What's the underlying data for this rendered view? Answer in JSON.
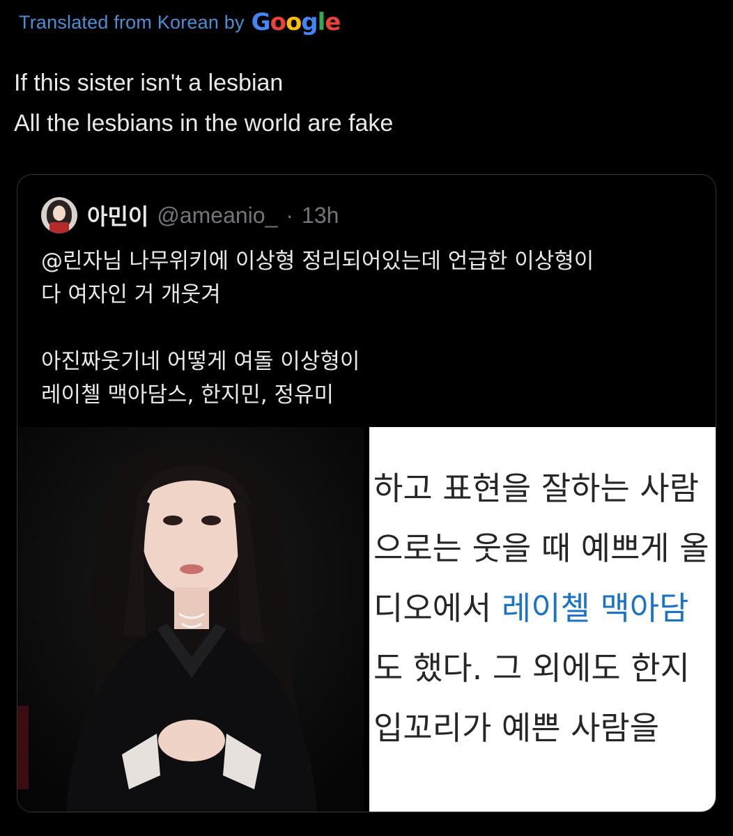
{
  "translation_banner": {
    "text": "Translated from Korean by",
    "logo": [
      "G",
      "o",
      "o",
      "g",
      "l",
      "e"
    ],
    "logo_colors": [
      "#4285f4",
      "#ea4335",
      "#fbbc05",
      "#4285f4",
      "#34a853",
      "#ea4335"
    ]
  },
  "tweet": {
    "lines": [
      "If this sister isn't a lesbian",
      "All the lesbians in the world are fake"
    ]
  },
  "quoted_tweet": {
    "avatar_icon": "profile-photo",
    "display_name": "아민이",
    "handle": "@ameanio_",
    "separator": "·",
    "time": "13h",
    "paragraph1": [
      "@린자님 나무위키에 이상형 정리되어있는데 언급한 이상형이",
      "다 여자인 거 개웃겨"
    ],
    "paragraph2": [
      "아진짜웃기네 어떻게 여돌 이상형이",
      "레이첼 맥아담스, 한지민, 정유미"
    ],
    "media": {
      "photo_description_icon": "woman-portrait-image",
      "document_lines": [
        {
          "before": "하고 표현을 잘하는 사람",
          "link": "",
          "after": ""
        },
        {
          "before": "으로는 웃을 때 예쁘게 올",
          "link": "",
          "after": ""
        },
        {
          "before": "디오에서 ",
          "link": "레이첼 맥아담",
          "after": ""
        },
        {
          "before": "도 했다. 그 외에도 한지",
          "link": "",
          "after": ""
        },
        {
          "before": "입꼬리가 예쁜 사람을",
          "link": "",
          "after": ""
        }
      ]
    }
  },
  "colors": {
    "background": "#000000",
    "text": "#e7e9ea",
    "muted": "#71767b",
    "banner_blue": "#4a8fd6",
    "border": "#333639",
    "doc_link": "#1a73c7"
  }
}
